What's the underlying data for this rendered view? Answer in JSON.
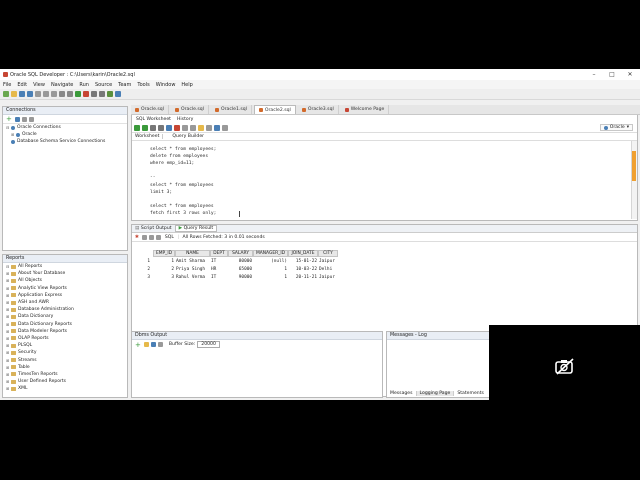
{
  "window": {
    "title": "Oracle SQL Developer : C:\\Users\\karin\\Oracle2.sql"
  },
  "menu": [
    "File",
    "Edit",
    "View",
    "Navigate",
    "Run",
    "Source",
    "Team",
    "Tools",
    "Window",
    "Help"
  ],
  "doc_tabs": [
    {
      "label": "Oracle.sql",
      "active": false
    },
    {
      "label": "Oracle.sql",
      "active": false
    },
    {
      "label": "Oracle1.sql",
      "active": false
    },
    {
      "label": "Oracle2.sql",
      "active": true
    },
    {
      "label": "Oracle3.sql",
      "active": false
    },
    {
      "label": "Welcome Page",
      "active": false
    }
  ],
  "editor": {
    "subtabs": [
      "SQL Worksheet",
      "History"
    ],
    "worksheet_tabs": [
      "Worksheet",
      "Query Builder"
    ],
    "connection": "Oracle",
    "lines": [
      "select * from employees;",
      "delete from employees",
      "where emp_id=11;",
      "",
      "--",
      "select * from employees",
      "limit 3;",
      "",
      "select * from employees",
      "fetch first 3 rows only;"
    ]
  },
  "connections_panel": {
    "title": "Connections",
    "items": [
      {
        "label": "Oracle Connections",
        "kind": "db",
        "indent": 0
      },
      {
        "label": "Oracle",
        "kind": "db",
        "indent": 1
      },
      {
        "label": "Database Schema Service Connections",
        "kind": "db",
        "indent": 0
      }
    ]
  },
  "reports_panel": {
    "title": "Reports",
    "items": [
      "All Reports",
      "About Your Database",
      "All Objects",
      "Analytic View Reports",
      "Application Express",
      "ASH and AWR",
      "Database Administration",
      "Data Dictionary",
      "Data Dictionary Reports",
      "Data Modeler Reports",
      "OLAP Reports",
      "PLSQL",
      "Security",
      "Streams",
      "Table",
      "TimesTen Reports",
      "User Defined Reports",
      "XML"
    ]
  },
  "results": {
    "tabs": [
      "Script Output",
      "Query Result"
    ],
    "status": "All Rows Fetched: 3 in 0.01 seconds",
    "sql_label": "SQL",
    "columns": [
      "EMP_ID",
      "NAME",
      "DEPT",
      "SALARY",
      "MANAGER_ID",
      "JOIN_DATE",
      "CITY"
    ],
    "rows": [
      {
        "n": "1",
        "emp_id": "1",
        "name": "Amit Sharma",
        "dept": "IT",
        "salary": "80000",
        "manager_id": "(null)",
        "join_date": "15-01-22",
        "city": "Jaipur"
      },
      {
        "n": "2",
        "emp_id": "2",
        "name": "Priya Singh",
        "dept": "HR",
        "salary": "65000",
        "manager_id": "1",
        "join_date": "10-03-22",
        "city": "Delhi"
      },
      {
        "n": "3",
        "emp_id": "3",
        "name": "Rahul Verma",
        "dept": "IT",
        "salary": "90000",
        "manager_id": "1",
        "join_date": "20-11-21",
        "city": "Jaipur"
      }
    ]
  },
  "dbms_output": {
    "title": "Dbms Output",
    "buffer_label": "Buffer Size:",
    "buffer_value": "20000"
  },
  "messages_log": {
    "title": "Messages - Log",
    "tabs": [
      "Messages",
      "Logging Page",
      "Statements"
    ]
  },
  "colors": {
    "accent": "#2c6fb7",
    "orange": "#f0a030",
    "oracle_red": "#c74634"
  },
  "overlay_icon": "no-camera-icon"
}
